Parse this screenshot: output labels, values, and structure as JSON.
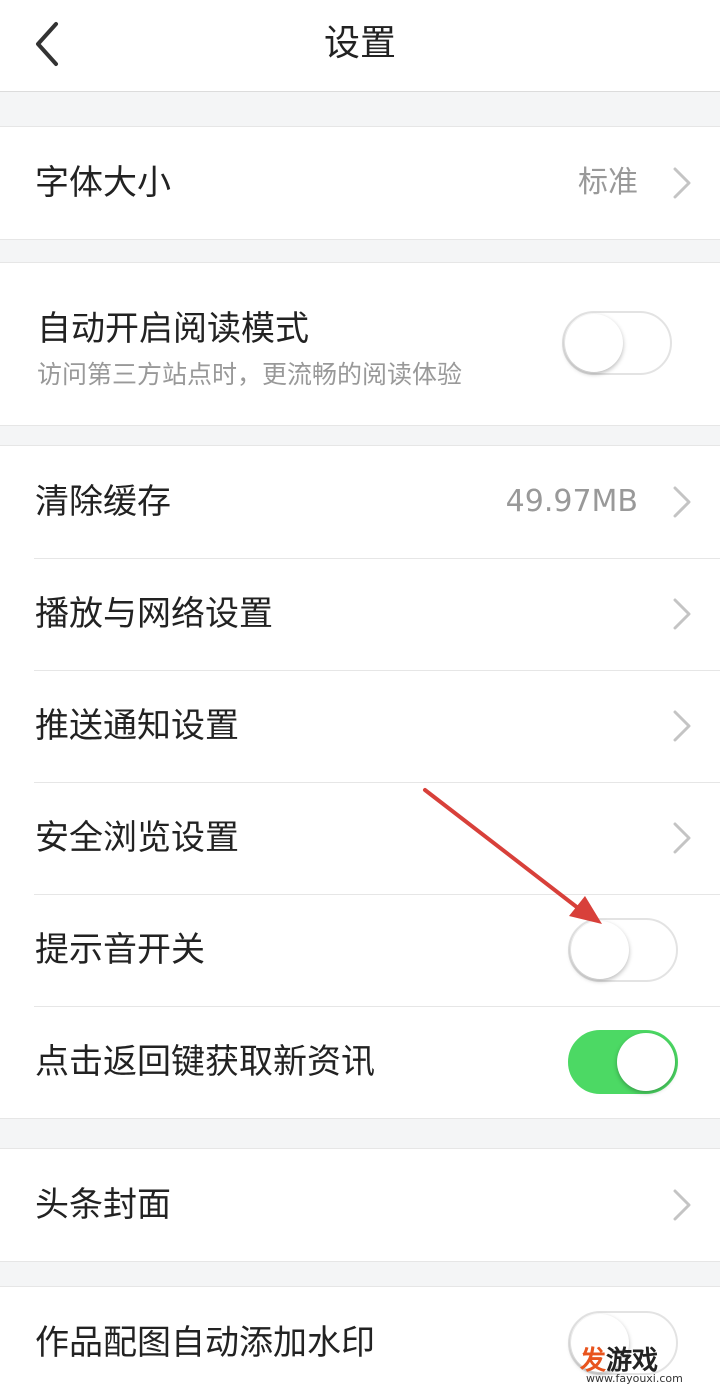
{
  "header": {
    "title": "设置",
    "back_icon": "chevron-left-icon"
  },
  "sections": {
    "font": {
      "label": "字体大小",
      "value": "标准"
    },
    "reading": {
      "title": "自动开启阅读模式",
      "subtitle": "访问第三方站点时，更流畅的阅读体验",
      "toggle_on": false
    },
    "general": {
      "clear_cache": {
        "label": "清除缓存",
        "value": "49.97MB"
      },
      "playback_network": {
        "label": "播放与网络设置"
      },
      "push_notification": {
        "label": "推送通知设置"
      },
      "safe_browsing": {
        "label": "安全浏览设置"
      },
      "sound_switch": {
        "label": "提示音开关",
        "toggle_on": false
      },
      "back_key_refresh": {
        "label": "点击返回键获取新资讯",
        "toggle_on": true
      }
    },
    "cover": {
      "label": "头条封面"
    },
    "watermark_setting": {
      "label": "作品配图自动添加水印",
      "toggle_on": false
    }
  },
  "watermark_logo": {
    "accent": "发",
    "text": "游戏",
    "url": "www.fayouxi.com"
  },
  "colors": {
    "toggle_on": "#4cd964",
    "annotation_arrow": "#d8403a",
    "secondary_text": "#999999",
    "logo_accent": "#e8541e"
  }
}
